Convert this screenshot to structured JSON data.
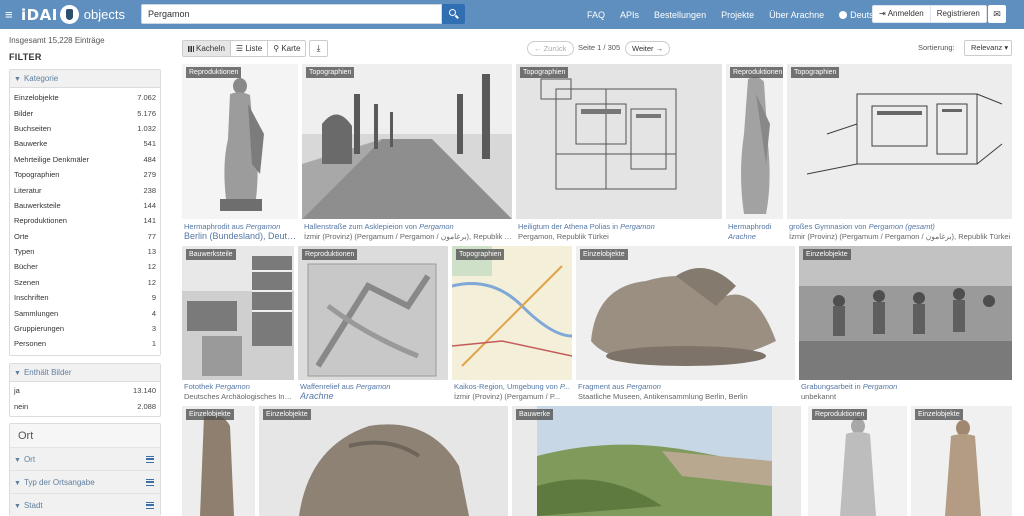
{
  "navbar": {
    "logo_main": "iDAI",
    "logo_sub": "objects",
    "search_value": "Pergamon",
    "links": [
      "FAQ",
      "APIs",
      "Bestellungen",
      "Projekte",
      "Über Arachne"
    ],
    "language": "Deutsch",
    "login": "Anmelden",
    "register": "Registrieren"
  },
  "sidebar": {
    "total": "Insgesamt 15,228 Einträge",
    "filter_title": "FILTER",
    "kategorie": {
      "title": "Kategorie",
      "items": [
        {
          "label": "Einzelobjekte",
          "count": "7.062"
        },
        {
          "label": "Bilder",
          "count": "5.176"
        },
        {
          "label": "Buchseiten",
          "count": "1.032"
        },
        {
          "label": "Bauwerke",
          "count": "541"
        },
        {
          "label": "Mehrteilige Denkmäler",
          "count": "484"
        },
        {
          "label": "Topographien",
          "count": "279"
        },
        {
          "label": "Literatur",
          "count": "238"
        },
        {
          "label": "Bauwerksteile",
          "count": "144"
        },
        {
          "label": "Reproduktionen",
          "count": "141"
        },
        {
          "label": "Orte",
          "count": "77"
        },
        {
          "label": "Typen",
          "count": "13"
        },
        {
          "label": "Bücher",
          "count": "12"
        },
        {
          "label": "Szenen",
          "count": "12"
        },
        {
          "label": "Inschriften",
          "count": "9"
        },
        {
          "label": "Sammlungen",
          "count": "4"
        },
        {
          "label": "Gruppierungen",
          "count": "3"
        },
        {
          "label": "Personen",
          "count": "1"
        }
      ]
    },
    "bilder": {
      "title": "Enthält Bilder",
      "items": [
        {
          "label": "ja",
          "count": "13.140"
        },
        {
          "label": "nein",
          "count": "2.088"
        }
      ]
    },
    "ort": {
      "title": "Ort",
      "rows": [
        "Ort",
        "Typ der Ortsangabe",
        "Stadt"
      ]
    }
  },
  "toolbar": {
    "views": [
      "Kacheln",
      "Liste",
      "Karte"
    ],
    "back": "Zurück",
    "page_info": "Seite 1 / 305",
    "next": "Weiter",
    "sort_label": "Sortierung:",
    "sort_value": "Relevanz"
  },
  "cards": {
    "r1": [
      {
        "badge": "Reproduktionen",
        "t1": "Hermaphrodit aus ",
        "t2": "Pergamon",
        "sub": "Berlin (Bundesland), Deutschl"
      },
      {
        "badge": "Topographien",
        "t1": "Hallenstraße zum Asklepieion von ",
        "t2": "Pergamon",
        "sub": "İzmir (Provinz) (Pergamum / Pergamon / برغامون), Republik Tür..."
      },
      {
        "badge": "Topographien",
        "t1": "Heiligtum der Athena Polias in ",
        "t2": "Pergamon",
        "sub": "Pergamon, Republik Türkei"
      },
      {
        "badge": "Reproduktionen",
        "t1": "Hermaphrodi",
        "t2": "",
        "sub": "Arachne"
      },
      {
        "badge": "Topographien",
        "t1": "großes Gymnasion von ",
        "t2": "Pergamon (gesamt)",
        "sub": "İzmir (Provinz) (Pergamum / Pergamon / برغامون), Republik Türkei"
      }
    ],
    "r2": [
      {
        "badge": "Bauwerksteile",
        "t1": "Fotothek ",
        "t2": "Pergamon",
        "sub": "Deutsches Archäologisches Ins..."
      },
      {
        "badge": "Reproduktionen",
        "t1": "Waffenrelief aus ",
        "t2": "Pergamon",
        "sub": "Arachne"
      },
      {
        "badge": "Topographien",
        "t1": "Kaikos-Region, Umgebung von ",
        "t2": "P...",
        "sub": "İzmir (Provinz) (Pergamum / P..."
      },
      {
        "badge": "Einzelobjekte",
        "t1": "Fragment aus ",
        "t2": "Pergamon",
        "sub": "Staatliche Museen, Antikensammlung Berlin, Berlin"
      },
      {
        "badge": "Einzelobjekte",
        "t1": "Grabungsarbeit in ",
        "t2": "Pergamon",
        "sub": "unbekannt"
      }
    ],
    "r3": [
      {
        "badge": "Einzelobjekte"
      },
      {
        "badge": "Einzelobjekte"
      },
      {
        "badge": "Bauwerke"
      },
      {
        "badge": "Reproduktionen"
      },
      {
        "badge": "Einzelobjekte"
      }
    ]
  },
  "colors": {
    "navbar": "#5f8fbf",
    "search_button": "#2f6fb2",
    "link": "#5577a6"
  }
}
